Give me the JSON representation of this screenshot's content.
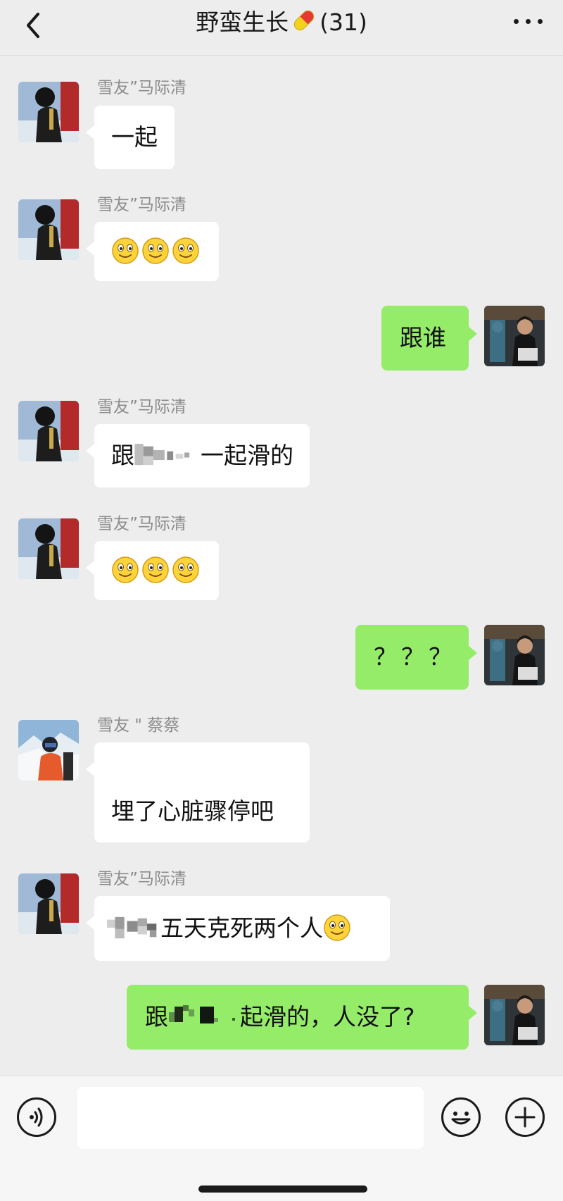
{
  "header": {
    "title_prefix": "野蛮生长",
    "title_suffix": "(31)",
    "back_icon": "chevron-left-icon",
    "pill_icon": "pill-capsule-icon",
    "more_icon": "more-dots-icon"
  },
  "messages": [
    {
      "sender": "雪友”马际清",
      "text": "一起"
    },
    {
      "sender": "雪友”马际清",
      "emojis": [
        "smile",
        "smile",
        "smile"
      ]
    },
    {
      "text": "跟谁"
    },
    {
      "sender": "雪友”马际清",
      "prefix": "跟",
      "text": "一起滑的"
    },
    {
      "sender": "雪友”马际清",
      "emojis": [
        "smile",
        "smile",
        "smile"
      ]
    },
    {
      "text": "？？？"
    },
    {
      "sender": "雪友 \" 蔡蔡",
      "text": "埋了心脏骤停吧"
    },
    {
      "sender": "雪友”马际清",
      "text": "五天克死两个人"
    },
    {
      "prefix": "跟",
      "text": "起滑的，人没了?"
    }
  ],
  "colors": {
    "background": "#ededed",
    "incoming_bubble": "#ffffff",
    "outgoing_bubble": "#95ec69",
    "sender_name": "#8b8b8b"
  },
  "inputbar": {
    "voice_icon": "voice-icon",
    "emoji_icon": "emoji-face-icon",
    "plus_icon": "plus-icon",
    "placeholder": ""
  }
}
